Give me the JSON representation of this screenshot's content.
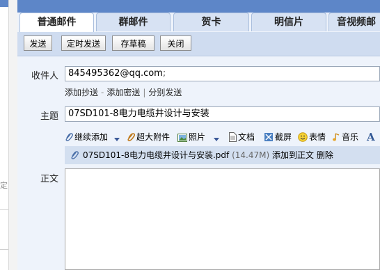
{
  "left": {
    "bracket_text": "定]"
  },
  "tabs": [
    {
      "label": "普通邮件",
      "active": true
    },
    {
      "label": "群邮件"
    },
    {
      "label": "贺卡"
    },
    {
      "label": "明信片"
    },
    {
      "label": "音视频邮"
    }
  ],
  "toolbar": {
    "send": "发送",
    "scheduled_send": "定时发送",
    "save_draft": "存草稿",
    "close": "关闭"
  },
  "form": {
    "recipient_label": "收件人",
    "recipient_value": "845495362@qq.com",
    "recipient_separator": ";",
    "add_cc": "添加抄送",
    "add_bcc": "添加密送",
    "separate_send": "分别发送",
    "link_separator_dash": "-",
    "link_separator_bar": "|",
    "subject_label": "主题",
    "subject_value": "07SD101-8电力电缆井设计与安装",
    "body_label": "正文"
  },
  "attach_toolbar": {
    "continue_add": "继续添加",
    "large_attachment": "超大附件",
    "photo": "照片",
    "document": "文档",
    "screenshot": "截屏",
    "emoticon": "表情",
    "music": "音乐",
    "font": "A"
  },
  "attachment": {
    "filename": "07SD101-8电力电缆井设计与安装.pdf",
    "size": "(14.47M)",
    "add_to_body": "添加到正文",
    "delete": "删除"
  },
  "colors": {
    "header_blue": "#5d86c8",
    "panel_bg": "#eef3fb",
    "toolbar_bg": "#cfdcf0",
    "attachment_row_bg": "#d3dff0"
  }
}
